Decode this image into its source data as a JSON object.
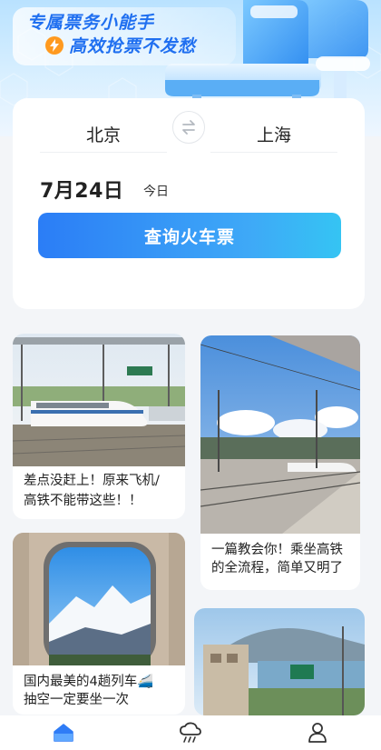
{
  "banner": {
    "slogan_line1": "专属票务小能手",
    "slogan_line2": "高效抢票不发愁",
    "icons": [
      "bolt-icon",
      "train-seat-illustration"
    ]
  },
  "search": {
    "from_city": "北京",
    "to_city": "上海",
    "swap_icon": "swap-arrows-icon",
    "date": "7月24日",
    "date_note": "今日",
    "query_button": "查询火车票"
  },
  "feed": {
    "items": [
      {
        "caption_line1": "差点没赶上！原来飞机/",
        "caption_line2": "高铁不能带这些！！"
      },
      {
        "caption_line1": "一篇教会你！乘坐高铁",
        "caption_line2": "的全流程，简单又明了"
      },
      {
        "caption_line1": "国内最美的4趟列车🚄",
        "caption_line2": "抽空一定要坐一次"
      },
      {
        "caption_line1": "",
        "caption_line2": ""
      }
    ]
  },
  "nav": {
    "items": [
      "home-icon",
      "weather-icon",
      "profile-icon"
    ],
    "active_color": "#2f7cf6",
    "inactive_color": "#333333"
  },
  "colors": {
    "accent": "#2b7df6",
    "slogan": "#1f6ff0",
    "bolt": "#ff9a1f"
  }
}
